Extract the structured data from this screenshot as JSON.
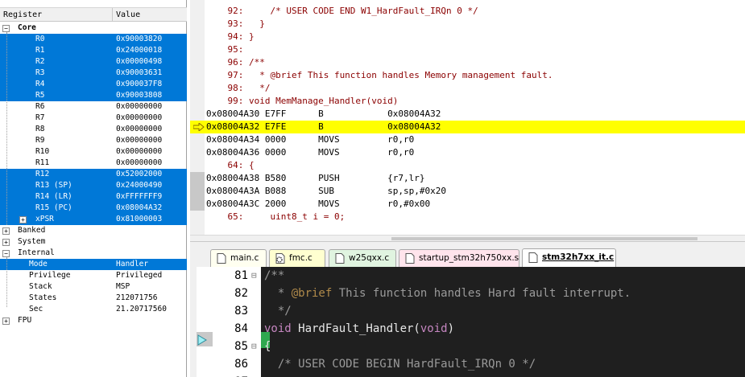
{
  "registers": {
    "header": {
      "name": "Register",
      "value": "Value"
    },
    "rows": [
      {
        "name": "Core",
        "value": "",
        "level": 0,
        "group": true,
        "expander": "−",
        "selected": false
      },
      {
        "name": "R0",
        "value": "0x90003820",
        "level": 2,
        "selected": true
      },
      {
        "name": "R1",
        "value": "0x24000018",
        "level": 2,
        "selected": true
      },
      {
        "name": "R2",
        "value": "0x00000498",
        "level": 2,
        "selected": true
      },
      {
        "name": "R3",
        "value": "0x90003631",
        "level": 2,
        "selected": true
      },
      {
        "name": "R4",
        "value": "0x900037F8",
        "level": 2,
        "selected": true
      },
      {
        "name": "R5",
        "value": "0x90003808",
        "level": 2,
        "selected": true
      },
      {
        "name": "R6",
        "value": "0x00000000",
        "level": 2,
        "selected": false
      },
      {
        "name": "R7",
        "value": "0x00000000",
        "level": 2,
        "selected": false
      },
      {
        "name": "R8",
        "value": "0x00000000",
        "level": 2,
        "selected": false
      },
      {
        "name": "R9",
        "value": "0x00000000",
        "level": 2,
        "selected": false
      },
      {
        "name": "R10",
        "value": "0x00000000",
        "level": 2,
        "selected": false
      },
      {
        "name": "R11",
        "value": "0x00000000",
        "level": 2,
        "selected": false
      },
      {
        "name": "R12",
        "value": "0x52002000",
        "level": 2,
        "selected": true
      },
      {
        "name": "R13 (SP)",
        "value": "0x24000490",
        "level": 2,
        "selected": true
      },
      {
        "name": "R14 (LR)",
        "value": "0xFFFFFFF9",
        "level": 2,
        "selected": true
      },
      {
        "name": "R15 (PC)",
        "value": "0x08004A32",
        "level": 2,
        "selected": true
      },
      {
        "name": "xPSR",
        "value": "0x81000003",
        "level": 2,
        "selected": true,
        "expander": "+"
      },
      {
        "name": "Banked",
        "value": "",
        "level": 0,
        "expander": "+",
        "selected": false
      },
      {
        "name": "System",
        "value": "",
        "level": 0,
        "expander": "+",
        "selected": false
      },
      {
        "name": "Internal",
        "value": "",
        "level": 0,
        "expander": "−",
        "selected": false
      },
      {
        "name": "Mode",
        "value": "Handler",
        "level": 1,
        "selected": true
      },
      {
        "name": "Privilege",
        "value": "Privileged",
        "level": 1,
        "selected": false
      },
      {
        "name": "Stack",
        "value": "MSP",
        "level": 1,
        "selected": false
      },
      {
        "name": "States",
        "value": "212071756",
        "level": 1,
        "selected": false
      },
      {
        "name": "Sec",
        "value": "21.20717560",
        "level": 1,
        "selected": false
      },
      {
        "name": "FPU",
        "value": "",
        "level": 0,
        "expander": "+",
        "selected": false
      }
    ]
  },
  "disassembly": {
    "lines": [
      {
        "kind": "src",
        "text": "    92:     /* USER CODE END W1_HardFault_IRQn 0 */"
      },
      {
        "kind": "src",
        "text": "    93:   }"
      },
      {
        "kind": "src",
        "text": "    94: }"
      },
      {
        "kind": "src",
        "text": "    95:"
      },
      {
        "kind": "src",
        "text": "    96: /**"
      },
      {
        "kind": "src",
        "text": "    97:   * @brief This function handles Memory management fault."
      },
      {
        "kind": "src",
        "text": "    98:   */"
      },
      {
        "kind": "src",
        "text": "    99: void MemManage_Handler(void)"
      },
      {
        "kind": "asm",
        "text": "0x08004A30 E7FF      B            0x08004A32"
      },
      {
        "kind": "asm",
        "text": "0x08004A32 E7FE      B            0x08004A32",
        "current": true
      },
      {
        "kind": "asm",
        "text": "0x08004A34 0000      MOVS         r0,r0"
      },
      {
        "kind": "asm",
        "text": "0x08004A36 0000      MOVS         r0,r0"
      },
      {
        "kind": "src",
        "text": "    64: {"
      },
      {
        "kind": "asm",
        "text": "0x08004A38 B580      PUSH         {r7,lr}"
      },
      {
        "kind": "asm",
        "text": "0x08004A3A B088      SUB          sp,sp,#0x20"
      },
      {
        "kind": "asm",
        "text": "0x08004A3C 2000      MOVS         r0,#0x00"
      },
      {
        "kind": "src",
        "text": "    65:     uint8_t i = 0;"
      }
    ]
  },
  "tabs": [
    {
      "label": "main.c",
      "active": false,
      "color": "#fffff0",
      "icon": "file-icon"
    },
    {
      "label": "fmc.c",
      "active": false,
      "color": "#ffffd0",
      "icon": "gear-file-icon"
    },
    {
      "label": "w25qxx.c",
      "active": false,
      "color": "#e0f4e0",
      "icon": "file-icon"
    },
    {
      "label": "startup_stm32h750xx.s",
      "active": false,
      "color": "#ffe4ec",
      "icon": "file-icon"
    },
    {
      "label": "stm32h7xx_it.c",
      "active": true,
      "color": "#ffffff",
      "icon": "file-icon"
    }
  ],
  "editor": {
    "lines": [
      {
        "num": "81",
        "fold": "⊟",
        "parts": [
          {
            "c": "c-comment",
            "t": "/**"
          }
        ]
      },
      {
        "num": "82",
        "parts": [
          {
            "c": "c-comment",
            "t": "  * "
          },
          {
            "c": "c-doc",
            "t": "@brief"
          },
          {
            "c": "c-comment",
            "t": " This function handles Hard fault interrupt."
          }
        ]
      },
      {
        "num": "83",
        "parts": [
          {
            "c": "c-comment",
            "t": "  */"
          }
        ]
      },
      {
        "num": "84",
        "parts": [
          {
            "c": "c-kw",
            "t": "void"
          },
          {
            "c": "c-plain",
            "t": " HardFault_Handler("
          },
          {
            "c": "c-kw",
            "t": "void"
          },
          {
            "c": "c-plain",
            "t": ")"
          }
        ]
      },
      {
        "num": "85",
        "fold": "⊟",
        "current": true,
        "parts": [
          {
            "c": "c-plain",
            "t": "{"
          }
        ]
      },
      {
        "num": "86",
        "parts": [
          {
            "c": "c-comment",
            "t": "  /* USER CODE BEGIN HardFault_IRQn 0 */"
          }
        ]
      },
      {
        "num": "87",
        "parts": [
          {
            "c": "c-plain",
            "t": ""
          }
        ]
      }
    ]
  },
  "colors": {
    "selection": "#0078d7",
    "current_line": "#ffff00",
    "source_text": "#8b0000",
    "editor_bg": "#1f1f1f"
  }
}
